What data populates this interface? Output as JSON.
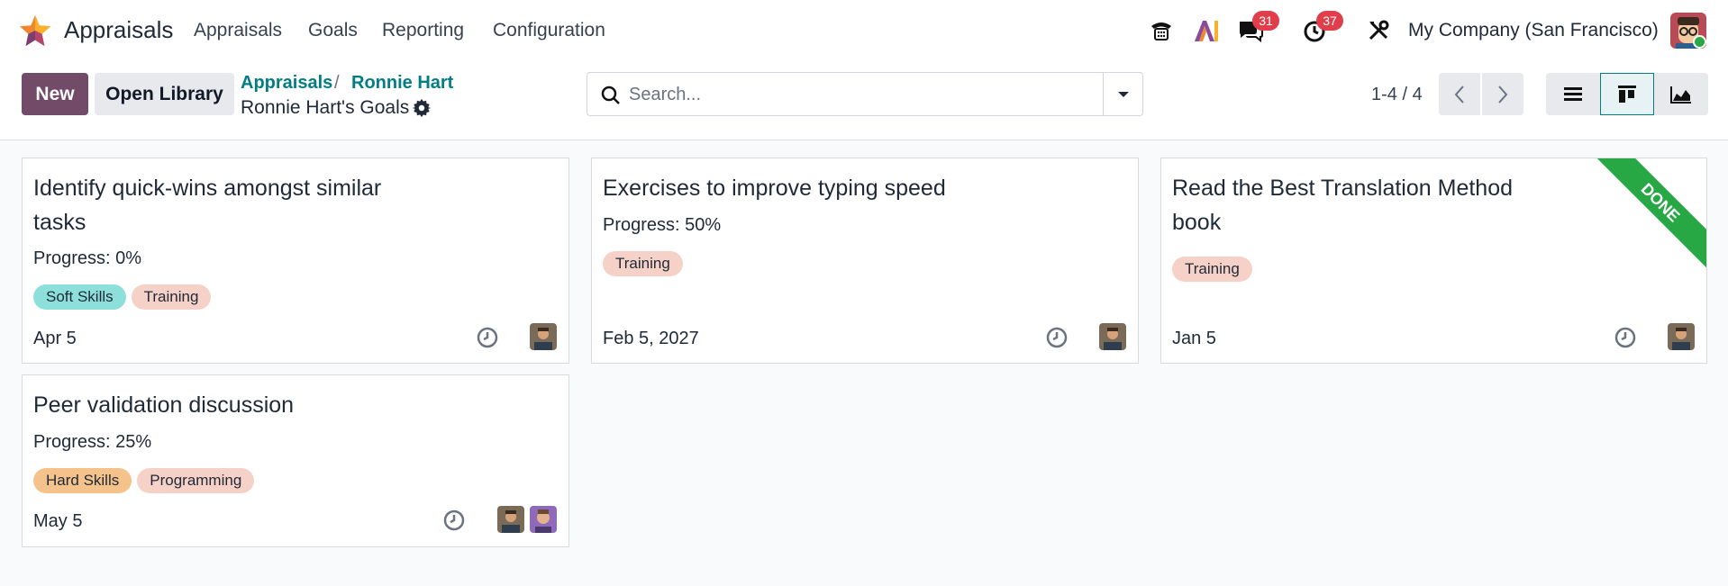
{
  "app": {
    "name": "Appraisals"
  },
  "menu": {
    "appraisals": "Appraisals",
    "goals": "Goals",
    "reporting": "Reporting",
    "configuration": "Configuration"
  },
  "systray": {
    "messages_count": "31",
    "activities_count": "37",
    "company": "My Company (San Francisco)"
  },
  "toolbar": {
    "new_label": "New",
    "library_label": "Open Library"
  },
  "breadcrumb": {
    "root": "Appraisals",
    "separator": "/",
    "parent": "Ronnie Hart",
    "current": "Ronnie Hart's Goals"
  },
  "search": {
    "placeholder": "Search..."
  },
  "pager": {
    "value": "1-4 / 4"
  },
  "colors": {
    "brand": "#714b67",
    "accent": "#017e84",
    "done": "#28a745",
    "badge": "#e03e4b"
  },
  "cards": [
    {
      "title_line1": "Identify quick-wins amongst similar",
      "title_line2": "tasks",
      "progress": "Progress: 0%",
      "tags": [
        "Soft Skills",
        "Training"
      ],
      "date": "Apr 5"
    },
    {
      "title_line1": "Exercises to improve typing speed",
      "progress": "Progress: 50%",
      "tags": [
        "Training"
      ],
      "date": "Feb 5, 2027"
    },
    {
      "title_line1": "Read the Best Translation Method",
      "title_line2": "book",
      "ribbon": "DONE",
      "tags": [
        "Training"
      ],
      "date": "Jan 5"
    },
    {
      "title_line1": "Peer validation discussion",
      "progress": "Progress: 25%",
      "tags": [
        "Hard Skills",
        "Programming"
      ],
      "date": "May 5"
    }
  ]
}
